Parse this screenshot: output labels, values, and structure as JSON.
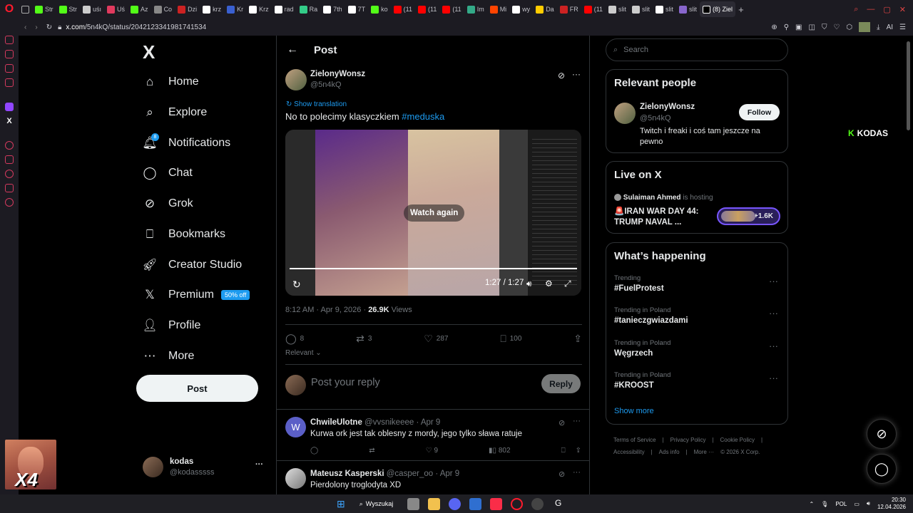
{
  "browser": {
    "tabs": [
      {
        "label": "Str",
        "color": "#53fc18"
      },
      {
        "label": "Str",
        "color": "#53fc18"
      },
      {
        "label": "uśı",
        "color": "#cccccc"
      },
      {
        "label": "Uś",
        "color": "#e03a5e"
      },
      {
        "label": "Az",
        "color": "#53fc18"
      },
      {
        "label": "Co",
        "color": "#888888",
        "active": false
      },
      {
        "label": "Dzi",
        "color": "#cc2222"
      },
      {
        "label": "krz",
        "color": "#ffffff"
      },
      {
        "label": "Kr",
        "color": "#3a60d0"
      },
      {
        "label": "Krz",
        "color": "#ffffff"
      },
      {
        "label": "rad",
        "color": "#ffffff"
      },
      {
        "label": "Ra",
        "color": "#33cc88"
      },
      {
        "label": "7th",
        "color": "#ffffff"
      },
      {
        "label": "7T",
        "color": "#ffffff"
      },
      {
        "label": "ko",
        "color": "#53fc18"
      },
      {
        "label": "(11",
        "color": "#ff0000"
      },
      {
        "label": "(11",
        "color": "#ff0000"
      },
      {
        "label": "(11",
        "color": "#ff0000"
      },
      {
        "label": "Im",
        "color": "#33aa88"
      },
      {
        "label": "Mi",
        "color": "#ff4400"
      },
      {
        "label": "wy",
        "color": "#ffffff"
      },
      {
        "label": "Da",
        "color": "#ffcc00"
      },
      {
        "label": "FR",
        "color": "#cc2222"
      },
      {
        "label": "(11",
        "color": "#ff0000"
      },
      {
        "label": "slit",
        "color": "#cccccc"
      },
      {
        "label": "slit",
        "color": "#cccccc"
      },
      {
        "label": "slit",
        "color": "#ffffff"
      },
      {
        "label": "slit",
        "color": "#8866cc"
      },
      {
        "label": "(8) Ziel",
        "color": "#000000",
        "active": true
      }
    ],
    "new_tab": "+",
    "url_host": "x.com",
    "url_path": "/5n4kQ/status/2042123341981741534",
    "ai_label": "AI"
  },
  "nav": {
    "logo": "X",
    "items": [
      {
        "label": "Home",
        "icon": "home-icon",
        "glyph": "⌂"
      },
      {
        "label": "Explore",
        "icon": "search-icon",
        "glyph": "⌕"
      },
      {
        "label": "Notifications",
        "icon": "bell-icon",
        "glyph": "🔔︎"
      },
      {
        "label": "Chat",
        "icon": "chat-icon",
        "glyph": "◯"
      },
      {
        "label": "Grok",
        "icon": "grok-icon",
        "glyph": "⊘"
      },
      {
        "label": "Bookmarks",
        "icon": "bookmark-icon",
        "glyph": "⎕"
      },
      {
        "label": "Creator Studio",
        "icon": "rocket-icon",
        "glyph": "🚀︎"
      },
      {
        "label": "Premium",
        "icon": "x-premium-icon",
        "glyph": "𝕏"
      },
      {
        "label": "Profile",
        "icon": "profile-icon",
        "glyph": "👤︎"
      },
      {
        "label": "More",
        "icon": "more-icon",
        "glyph": "⋯"
      }
    ],
    "notif_count": "8",
    "premium_badge": "50% off",
    "post_button": "Post",
    "account_name": "kodas",
    "account_handle": "@kodasssss",
    "account_more": "···"
  },
  "main": {
    "header_title": "Post",
    "author_name": "ZielonyWonsz",
    "author_handle": "@5n4kQ",
    "show_translation": "Show translation",
    "tweet_text": "No to polecimy klasyczkiem ",
    "tweet_tag": "#meduska",
    "video": {
      "watch_again": "Watch again",
      "time": "1:27 / 1:27"
    },
    "meta_time": "8:12 AM · Apr 9, 2026 · ",
    "meta_views_count": "26.9K",
    "meta_views_label": " Views",
    "actions": {
      "replies": "8",
      "reposts": "3",
      "likes": "287",
      "bookmarks": "100"
    },
    "relevant": "Relevant",
    "reply_placeholder": "Post your reply",
    "reply_button": "Reply",
    "replies": [
      {
        "name": "ChwileUlotne",
        "handle": "@vvsnikeeee · Apr 9",
        "text": "Kurwa ork jest tak oblesny z mordy, jego tylko sława ratuje",
        "likes": "9",
        "views": "802",
        "avatar_letter": "W"
      },
      {
        "name": "Mateusz Kasperski",
        "handle": "@casper_oo · Apr 9",
        "text": "Pierdolony troglodyta XD"
      }
    ]
  },
  "right": {
    "search_placeholder": "Search",
    "relevant_people": {
      "title": "Relevant people",
      "name": "ZielonyWonsz",
      "handle": "@5n4kQ",
      "bio": "Twitch i freaki i coś tam jeszcze na pewno",
      "follow": "Follow"
    },
    "live": {
      "title": "Live on X",
      "host": "Sulaiman Ahmed",
      "hosting": " is hosting",
      "headline": "🚨IRAN WAR DAY 44: TRUMP NAVAL ...",
      "listeners": "+1.6K"
    },
    "happening": {
      "title": "What’s happening",
      "trends": [
        {
          "context": "Trending",
          "topic": "#FuelProtest"
        },
        {
          "context": "Trending in Poland",
          "topic": "#tanieczgwiazdami"
        },
        {
          "context": "Trending in Poland",
          "topic": "Węgrzech"
        },
        {
          "context": "Trending in Poland",
          "topic": "#KROOST"
        }
      ],
      "show_more": "Show more"
    },
    "footer_row1": [
      "Terms of Service",
      "|",
      "Privacy Policy",
      "|",
      "Cookie Policy",
      "|"
    ],
    "footer_row2": [
      "Accessibility",
      "|",
      "Ads info",
      "|",
      "More ···",
      "© 2026 X Corp."
    ]
  },
  "overlay": {
    "kodas_label": "KODAS",
    "kodas_mark": "K",
    "webcam_text": "X4"
  },
  "taskbar": {
    "search": "Wyszukaj",
    "lang": "POL",
    "time": "20:30",
    "date": "12.04.2026"
  },
  "colors": {
    "accent": "#1d9bf0",
    "kick": "#53fc18",
    "bg": "#000000",
    "border": "#2f3336",
    "muted": "#71767b"
  }
}
